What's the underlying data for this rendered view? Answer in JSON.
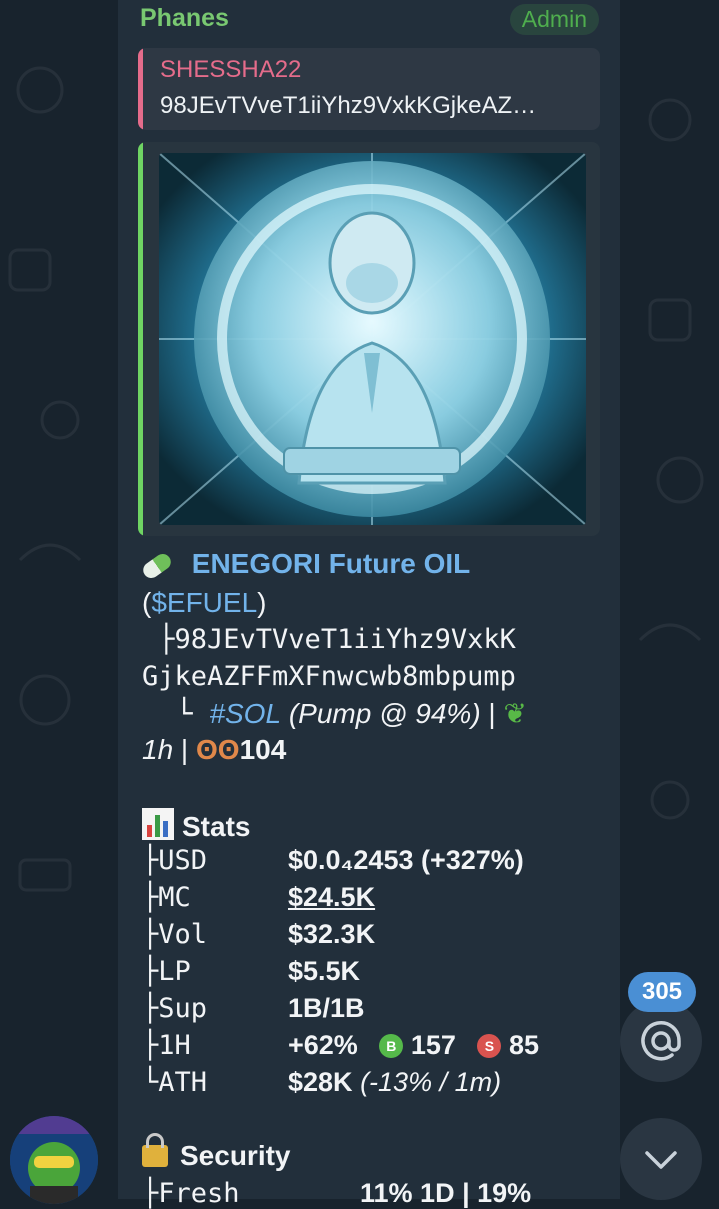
{
  "message": {
    "sender": "Phanes",
    "role_badge": "Admin",
    "reply": {
      "name": "SHESSHA22",
      "text": "98JEvTVveT1iiYhz9VxkKGjkeAZ…"
    },
    "token": {
      "name": "ENEGORI Future OIL",
      "ticker_open": "(",
      "ticker": "$EFUEL",
      "ticker_close": ")",
      "address_line1": "98JEvTVveT1iiYhz9VxkK",
      "address_line2": "GjkeAZFFmXFnwcwb8mbpump",
      "chain": "#SOL",
      "pump": "(Pump @ 94%)",
      "sep": " | ",
      "age": "1h",
      "views": "104"
    },
    "stats": {
      "title": "Stats",
      "rows": [
        {
          "key": "USD",
          "value": "$0.0₄2453 (+327%)"
        },
        {
          "key": "MC",
          "value": "$24.5K"
        },
        {
          "key": "Vol",
          "value": "$32.3K"
        },
        {
          "key": "LP",
          "value": "$5.5K"
        },
        {
          "key": "Sup",
          "value": "1B/1B"
        },
        {
          "key": "1H",
          "value": "+62%",
          "buys": "157",
          "sells": "85"
        },
        {
          "key": "ATH",
          "value": "$28K",
          "extra": "(-13% / 1m)"
        }
      ]
    },
    "security": {
      "title": "Security",
      "first_row_key": "Fresh",
      "first_row_value": "11% 1D | 19%"
    }
  },
  "ui": {
    "mention_count": "305",
    "mention_icon": "at-icon",
    "scroll_icon": "chevron-down-icon"
  },
  "colors": {
    "background": "#18232d",
    "bubble": "#222f3b",
    "sender": "#79c871",
    "reply_accent": "#e56c8b",
    "link": "#72b3ea",
    "badge": "#4a8fd4"
  }
}
